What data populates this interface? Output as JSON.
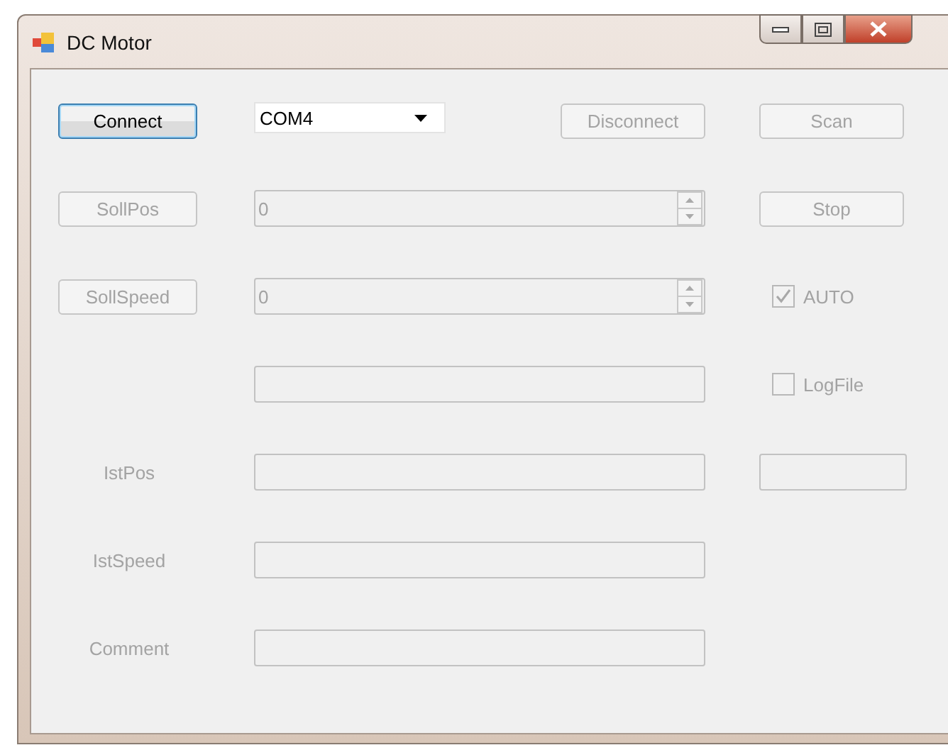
{
  "window": {
    "title": "DC Motor"
  },
  "rows": [
    {
      "left": {
        "kind": "button",
        "label": "Connect",
        "disabled": false
      },
      "middle": [
        {
          "kind": "dropdown",
          "value": "COM4",
          "disabled": false
        },
        {
          "kind": "button",
          "label": "Disconnect",
          "disabled": true
        }
      ],
      "right": {
        "kind": "button",
        "label": "Scan",
        "disabled": true
      }
    },
    {
      "left": {
        "kind": "button",
        "label": "SollPos",
        "disabled": true
      },
      "middle": [
        {
          "kind": "spinbox",
          "value": "0",
          "disabled": true
        }
      ],
      "right": {
        "kind": "button",
        "label": "Stop",
        "disabled": true
      }
    },
    {
      "left": {
        "kind": "button",
        "label": "SollSpeed",
        "disabled": true
      },
      "middle": [
        {
          "kind": "spinbox",
          "value": "0",
          "disabled": true
        }
      ],
      "right": {
        "kind": "checkbox",
        "label": "AUTO",
        "checked": true,
        "disabled": true
      }
    },
    {
      "middle": [
        {
          "kind": "textbox",
          "disabled": true
        }
      ],
      "right": {
        "kind": "checkbox",
        "label": "LogFile",
        "checked": false,
        "disabled": true
      }
    },
    {
      "left": {
        "kind": "label",
        "label": "IstPos",
        "disabled": true
      },
      "middle": [
        {
          "kind": "textbox",
          "disabled": true
        }
      ],
      "right": {
        "kind": "textbox",
        "disabled": true
      }
    },
    {
      "left": {
        "kind": "label",
        "label": "IstSpeed",
        "disabled": true
      },
      "middle": [
        {
          "kind": "textbox",
          "disabled": true
        }
      ]
    },
    {
      "left": {
        "kind": "label",
        "label": "Comment",
        "disabled": true
      },
      "middle": [
        {
          "kind": "textbox",
          "disabled": true
        }
      ]
    }
  ]
}
